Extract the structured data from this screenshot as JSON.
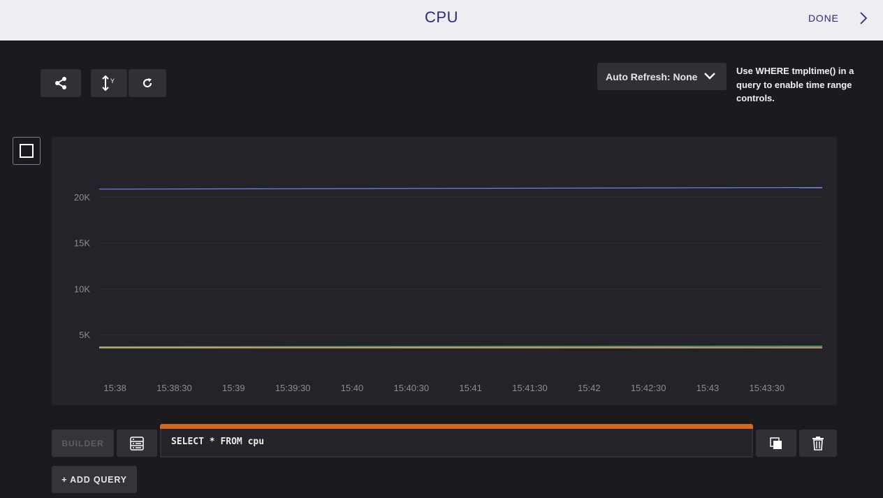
{
  "header": {
    "title": "CPU",
    "done_label": "DONE"
  },
  "toolbar": {
    "share_icon": "share-icon",
    "y_axis_icon": "y-axis-range-icon",
    "y_axis_label": "Y",
    "refresh_icon": "refresh-icon",
    "auto_refresh_label": "Auto Refresh: None",
    "time_hint": "Use WHERE tmpltime() in a query to enable time range controls."
  },
  "chart_data": {
    "type": "line",
    "y_ticks": [
      "5K",
      "10K",
      "15K",
      "20K"
    ],
    "x_ticks": [
      "15:38",
      "15:38:30",
      "15:39",
      "15:39:30",
      "15:40",
      "15:40:30",
      "15:41",
      "15:41:30",
      "15:42",
      "15:42:30",
      "15:43",
      "15:43:30"
    ],
    "ylim": [
      2200,
      23500
    ],
    "xlim": [
      "15:37:52",
      "15:43:58"
    ],
    "grid": true,
    "series": [
      {
        "color": "#7a86e8",
        "x": [
          "15:37:52",
          "15:43:58"
        ],
        "values": [
          20850,
          21030
        ]
      },
      {
        "color": "#4fbf6a",
        "x": [
          "15:37:52",
          "15:43:58"
        ],
        "values": [
          3680,
          3750
        ]
      },
      {
        "color": "#d08a8a",
        "x": [
          "15:37:52",
          "15:43:58"
        ],
        "values": [
          3620,
          3620
        ]
      },
      {
        "color": "#c9a56b",
        "x": [
          "15:37:52",
          "15:43:58"
        ],
        "values": [
          3560,
          3560
        ]
      }
    ]
  },
  "query": {
    "builder_label": "BUILDER",
    "text": "SELECT * FROM cpu",
    "add_label": "+ ADD QUERY",
    "accent": "#d2691e"
  }
}
